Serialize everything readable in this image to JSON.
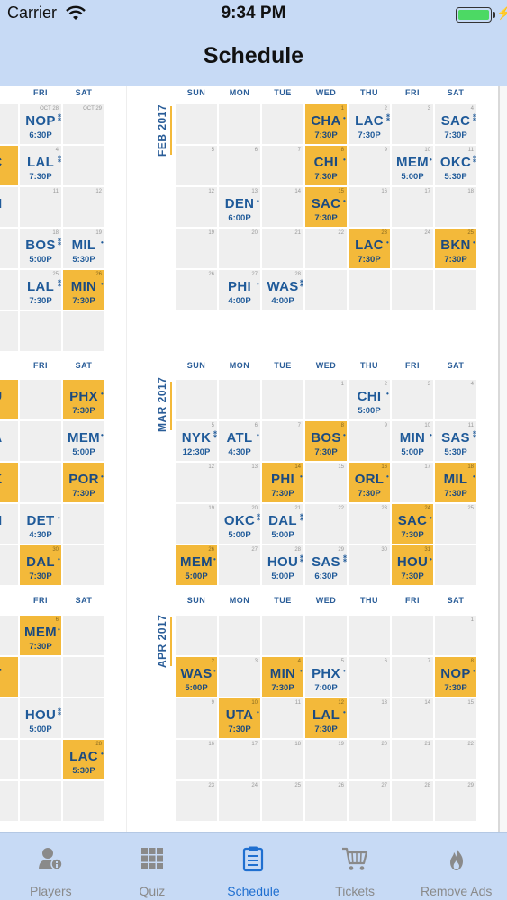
{
  "status_bar": {
    "carrier": "Carrier",
    "time": "9:34 PM"
  },
  "nav": {
    "title": "Schedule"
  },
  "left_page": {
    "headers": [
      "U",
      "FRI",
      "SAT"
    ],
    "feb": [
      {
        "row": 0,
        "col": 1,
        "date": "OCT 28",
        "team": "NOP",
        "mark": "⁑",
        "time": "6:30P",
        "home": false
      },
      {
        "row": 0,
        "col": 2,
        "date": "OCT 29",
        "team": "",
        "mark": "",
        "time": "",
        "home": false
      },
      {
        "row": 1,
        "col": 0,
        "date": "",
        "team": "C",
        "mark": "",
        "time": "",
        "home": true
      },
      {
        "row": 1,
        "col": 1,
        "date": "4",
        "team": "LAL",
        "mark": "⁑",
        "time": "7:30P",
        "home": false
      },
      {
        "row": 2,
        "col": 0,
        "date": "",
        "team": "N",
        "mark": "",
        "time": "",
        "home": false
      },
      {
        "row": 2,
        "col": 1,
        "date": "11",
        "team": "",
        "mark": "",
        "time": "",
        "home": false
      },
      {
        "row": 2,
        "col": 2,
        "date": "12",
        "team": "",
        "mark": "",
        "time": "",
        "home": false
      },
      {
        "row": 3,
        "col": 1,
        "date": "18",
        "team": "BOS",
        "mark": "⁑",
        "time": "5:00P",
        "home": false
      },
      {
        "row": 3,
        "col": 2,
        "date": "19",
        "team": "MIL",
        "mark": "•",
        "time": "5:30P",
        "home": false
      },
      {
        "row": 4,
        "col": 1,
        "date": "25",
        "team": "LAL",
        "mark": "⁑",
        "time": "7:30P",
        "home": false
      },
      {
        "row": 4,
        "col": 2,
        "date": "26",
        "team": "MIN",
        "mark": "•",
        "time": "7:30P",
        "home": true
      }
    ],
    "mar": [
      {
        "row": 0,
        "col": 0,
        "date": "",
        "team": "U",
        "mark": "",
        "time": "",
        "home": true
      },
      {
        "row": 0,
        "col": 2,
        "date": "",
        "team": "PHX",
        "mark": "•",
        "time": "7:30P",
        "home": true
      },
      {
        "row": 1,
        "col": 0,
        "date": "",
        "team": "A",
        "mark": "",
        "time": "",
        "home": false
      },
      {
        "row": 1,
        "col": 2,
        "date": "",
        "team": "MEM",
        "mark": "•",
        "time": "5:00P",
        "home": false
      },
      {
        "row": 2,
        "col": 0,
        "date": "",
        "team": "K",
        "mark": "",
        "time": "",
        "home": true
      },
      {
        "row": 2,
        "col": 2,
        "date": "",
        "team": "POR",
        "mark": "•",
        "time": "7:30P",
        "home": true
      },
      {
        "row": 3,
        "col": 0,
        "date": "",
        "team": "N",
        "mark": "",
        "time": "",
        "home": false
      },
      {
        "row": 3,
        "col": 1,
        "date": "",
        "team": "DET",
        "mark": "•",
        "time": "4:30P",
        "home": false
      },
      {
        "row": 4,
        "col": 1,
        "date": "30",
        "team": "DAL",
        "mark": "•",
        "time": "7:30P",
        "home": true
      }
    ],
    "apr": [
      {
        "row": 0,
        "col": 1,
        "date": "6",
        "team": "MEM",
        "mark": "•",
        "time": "7:30P",
        "home": true
      },
      {
        "row": 1,
        "col": 0,
        "date": "",
        "team": "T",
        "mark": "",
        "time": "",
        "home": true
      },
      {
        "row": 2,
        "col": 1,
        "date": "",
        "team": "HOU",
        "mark": "⁑",
        "time": "5:00P",
        "home": false
      },
      {
        "row": 3,
        "col": 2,
        "date": "28",
        "team": "LAC",
        "mark": "•",
        "time": "5:30P",
        "home": true
      }
    ]
  },
  "calendar": {
    "headers": [
      "SUN",
      "MON",
      "TUE",
      "WED",
      "THU",
      "FRI",
      "SAT"
    ],
    "months": [
      {
        "label": "FEB 2017",
        "games": [
          {
            "row": 0,
            "col": 3,
            "date": "1",
            "team": "CHA",
            "mark": "•",
            "time": "7:30P",
            "home": true
          },
          {
            "row": 0,
            "col": 4,
            "date": "2",
            "team": "LAC",
            "mark": "⁑",
            "time": "7:30P",
            "home": false
          },
          {
            "row": 0,
            "col": 6,
            "date": "4",
            "team": "SAC",
            "mark": "⁑",
            "time": "7:30P",
            "home": false
          },
          {
            "row": 1,
            "col": 3,
            "date": "8",
            "team": "CHI",
            "mark": "•",
            "time": "7:30P",
            "home": true
          },
          {
            "row": 1,
            "col": 5,
            "date": "10",
            "team": "MEM",
            "mark": "•",
            "time": "5:00P",
            "home": false
          },
          {
            "row": 1,
            "col": 6,
            "date": "11",
            "team": "OKC",
            "mark": "⁑",
            "time": "5:30P",
            "home": false
          },
          {
            "row": 2,
            "col": 1,
            "date": "13",
            "team": "DEN",
            "mark": "•",
            "time": "6:00P",
            "home": false
          },
          {
            "row": 2,
            "col": 3,
            "date": "15",
            "team": "SAC",
            "mark": "•",
            "time": "7:30P",
            "home": true
          },
          {
            "row": 3,
            "col": 4,
            "date": "23",
            "team": "LAC",
            "mark": "•",
            "time": "7:30P",
            "home": true
          },
          {
            "row": 3,
            "col": 6,
            "date": "25",
            "team": "BKN",
            "mark": "•",
            "time": "7:30P",
            "home": true
          },
          {
            "row": 4,
            "col": 1,
            "date": "27",
            "team": "PHI",
            "mark": "•",
            "time": "4:00P",
            "home": false
          },
          {
            "row": 4,
            "col": 2,
            "date": "28",
            "team": "WAS",
            "mark": "⁑",
            "time": "4:00P",
            "home": false
          }
        ],
        "plain": [
          {
            "row": 0,
            "col": 5,
            "date": "3"
          },
          {
            "row": 1,
            "col": 0,
            "date": "5"
          },
          {
            "row": 1,
            "col": 1,
            "date": "6"
          },
          {
            "row": 1,
            "col": 2,
            "date": "7"
          },
          {
            "row": 1,
            "col": 4,
            "date": "9"
          },
          {
            "row": 2,
            "col": 0,
            "date": "12"
          },
          {
            "row": 2,
            "col": 2,
            "date": "14"
          },
          {
            "row": 2,
            "col": 4,
            "date": "16"
          },
          {
            "row": 2,
            "col": 5,
            "date": "17"
          },
          {
            "row": 2,
            "col": 6,
            "date": "18"
          },
          {
            "row": 3,
            "col": 0,
            "date": "19"
          },
          {
            "row": 3,
            "col": 1,
            "date": "20"
          },
          {
            "row": 3,
            "col": 2,
            "date": "21"
          },
          {
            "row": 3,
            "col": 3,
            "date": "22"
          },
          {
            "row": 3,
            "col": 5,
            "date": "24"
          },
          {
            "row": 4,
            "col": 0,
            "date": "26"
          }
        ],
        "first_row_blank": [
          0,
          1,
          2
        ],
        "last_row_blank": [
          3,
          4,
          5,
          6
        ]
      },
      {
        "label": "MAR 2017",
        "games": [
          {
            "row": 0,
            "col": 4,
            "date": "2",
            "team": "CHI",
            "mark": "•",
            "time": "5:00P",
            "home": false
          },
          {
            "row": 1,
            "col": 0,
            "date": "5",
            "team": "NYK",
            "mark": "⁑",
            "time": "12:30P",
            "home": false
          },
          {
            "row": 1,
            "col": 1,
            "date": "6",
            "team": "ATL",
            "mark": "•",
            "time": "4:30P",
            "home": false
          },
          {
            "row": 1,
            "col": 3,
            "date": "8",
            "team": "BOS",
            "mark": "•",
            "time": "7:30P",
            "home": true
          },
          {
            "row": 1,
            "col": 5,
            "date": "10",
            "team": "MIN",
            "mark": "•",
            "time": "5:00P",
            "home": false
          },
          {
            "row": 1,
            "col": 6,
            "date": "11",
            "team": "SAS",
            "mark": "⁑",
            "time": "5:30P",
            "home": false
          },
          {
            "row": 2,
            "col": 2,
            "date": "14",
            "team": "PHI",
            "mark": "•",
            "time": "7:30P",
            "home": true
          },
          {
            "row": 2,
            "col": 4,
            "date": "16",
            "team": "ORL",
            "mark": "•",
            "time": "7:30P",
            "home": true
          },
          {
            "row": 2,
            "col": 6,
            "date": "18",
            "team": "MIL",
            "mark": "•",
            "time": "7:30P",
            "home": true
          },
          {
            "row": 3,
            "col": 1,
            "date": "20",
            "team": "OKC",
            "mark": "⁑",
            "time": "5:00P",
            "home": false
          },
          {
            "row": 3,
            "col": 2,
            "date": "21",
            "team": "DAL",
            "mark": "⁑",
            "time": "5:00P",
            "home": false
          },
          {
            "row": 3,
            "col": 5,
            "date": "24",
            "team": "SAC",
            "mark": "•",
            "time": "7:30P",
            "home": true
          },
          {
            "row": 4,
            "col": 0,
            "date": "26",
            "team": "MEM",
            "mark": "•",
            "time": "5:00P",
            "home": true
          },
          {
            "row": 4,
            "col": 2,
            "date": "28",
            "team": "HOU",
            "mark": "⁑",
            "time": "5:00P",
            "home": false
          },
          {
            "row": 4,
            "col": 3,
            "date": "29",
            "team": "SAS",
            "mark": "⁑",
            "time": "6:30P",
            "home": false
          },
          {
            "row": 4,
            "col": 5,
            "date": "31",
            "team": "HOU",
            "mark": "•",
            "time": "7:30P",
            "home": true
          }
        ],
        "plain": [
          {
            "row": 0,
            "col": 3,
            "date": "1"
          },
          {
            "row": 0,
            "col": 5,
            "date": "3"
          },
          {
            "row": 0,
            "col": 6,
            "date": "4"
          },
          {
            "row": 1,
            "col": 2,
            "date": "7"
          },
          {
            "row": 1,
            "col": 4,
            "date": "9"
          },
          {
            "row": 2,
            "col": 0,
            "date": "12"
          },
          {
            "row": 2,
            "col": 1,
            "date": "13"
          },
          {
            "row": 2,
            "col": 3,
            "date": "15"
          },
          {
            "row": 2,
            "col": 5,
            "date": "17"
          },
          {
            "row": 3,
            "col": 0,
            "date": "19"
          },
          {
            "row": 3,
            "col": 3,
            "date": "22"
          },
          {
            "row": 3,
            "col": 4,
            "date": "23"
          },
          {
            "row": 3,
            "col": 6,
            "date": "25"
          },
          {
            "row": 4,
            "col": 1,
            "date": "27"
          },
          {
            "row": 4,
            "col": 4,
            "date": "30"
          }
        ],
        "first_row_blank": [
          0,
          1,
          2
        ],
        "last_row_blank": [
          6
        ]
      },
      {
        "label": "APR 2017",
        "games": [
          {
            "row": 1,
            "col": 0,
            "date": "2",
            "team": "WAS",
            "mark": "•",
            "time": "5:00P",
            "home": true
          },
          {
            "row": 1,
            "col": 2,
            "date": "4",
            "team": "MIN",
            "mark": "•",
            "time": "7:30P",
            "home": true
          },
          {
            "row": 1,
            "col": 3,
            "date": "5",
            "team": "PHX",
            "mark": "•",
            "time": "7:00P",
            "home": false
          },
          {
            "row": 1,
            "col": 6,
            "date": "8",
            "team": "NOP",
            "mark": "•",
            "time": "7:30P",
            "home": true
          },
          {
            "row": 2,
            "col": 1,
            "date": "10",
            "team": "UTA",
            "mark": "•",
            "time": "7:30P",
            "home": true
          },
          {
            "row": 2,
            "col": 3,
            "date": "12",
            "team": "LAL",
            "mark": "•",
            "time": "7:30P",
            "home": true
          }
        ],
        "plain": [
          {
            "row": 0,
            "col": 6,
            "date": "1"
          },
          {
            "row": 1,
            "col": 1,
            "date": "3"
          },
          {
            "row": 1,
            "col": 4,
            "date": "6"
          },
          {
            "row": 1,
            "col": 5,
            "date": "7"
          },
          {
            "row": 2,
            "col": 0,
            "date": "9"
          },
          {
            "row": 2,
            "col": 2,
            "date": "11"
          },
          {
            "row": 2,
            "col": 4,
            "date": "13"
          },
          {
            "row": 2,
            "col": 5,
            "date": "14"
          },
          {
            "row": 2,
            "col": 6,
            "date": "15"
          },
          {
            "row": 3,
            "col": 0,
            "date": "16"
          },
          {
            "row": 3,
            "col": 1,
            "date": "17"
          },
          {
            "row": 3,
            "col": 2,
            "date": "18"
          },
          {
            "row": 3,
            "col": 3,
            "date": "19"
          },
          {
            "row": 3,
            "col": 4,
            "date": "20"
          },
          {
            "row": 3,
            "col": 5,
            "date": "21"
          },
          {
            "row": 3,
            "col": 6,
            "date": "22"
          },
          {
            "row": 4,
            "col": 0,
            "date": "23"
          },
          {
            "row": 4,
            "col": 1,
            "date": "24"
          },
          {
            "row": 4,
            "col": 2,
            "date": "25"
          },
          {
            "row": 4,
            "col": 3,
            "date": "26"
          },
          {
            "row": 4,
            "col": 4,
            "date": "27"
          },
          {
            "row": 4,
            "col": 5,
            "date": "28"
          },
          {
            "row": 4,
            "col": 6,
            "date": "29"
          }
        ],
        "first_row_blank": [
          0,
          1,
          2,
          3,
          4,
          5
        ],
        "last_row_blank": []
      }
    ]
  },
  "tabs": [
    {
      "label": "Players",
      "icon": "players-icon",
      "active": false
    },
    {
      "label": "Quiz",
      "icon": "quiz-grid-icon",
      "active": false
    },
    {
      "label": "Schedule",
      "icon": "clipboard-icon",
      "active": true
    },
    {
      "label": "Tickets",
      "icon": "cart-icon",
      "active": false
    },
    {
      "label": "Remove Ads",
      "icon": "flame-icon",
      "active": false
    }
  ],
  "colors": {
    "accent": "#1f6fd0",
    "home_game": "#f3b93a",
    "team_text": "#1f5a99",
    "cell": "#efefef",
    "bar": "#c7daf5"
  }
}
